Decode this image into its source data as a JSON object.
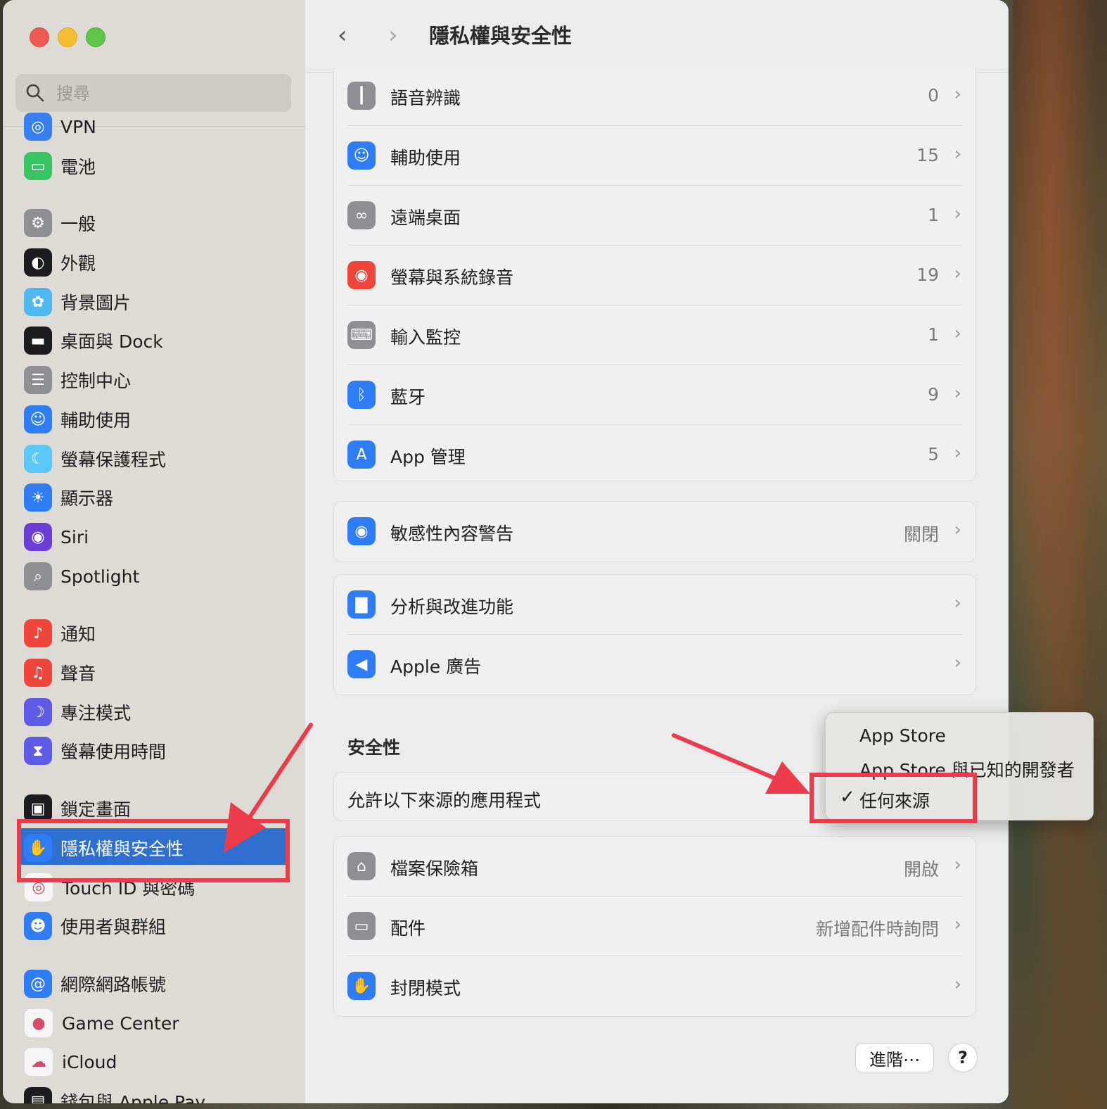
{
  "window": {
    "title": "隱私權與安全性"
  },
  "search": {
    "placeholder": "搜尋"
  },
  "sidebar": {
    "items": [
      {
        "label": "VPN",
        "icon": "vpn-icon",
        "color": "#3a7ff0"
      },
      {
        "label": "電池",
        "icon": "battery-icon",
        "color": "#38c463"
      },
      {
        "label": "一般",
        "icon": "gear-icon",
        "color": "#8e8e93"
      },
      {
        "label": "外觀",
        "icon": "appearance-icon",
        "color": "#1c1c1e"
      },
      {
        "label": "背景圖片",
        "icon": "wallpaper-icon",
        "color": "#4fb8f0"
      },
      {
        "label": "桌面與 Dock",
        "icon": "dock-icon",
        "color": "#1c1c1e"
      },
      {
        "label": "控制中心",
        "icon": "control-center-icon",
        "color": "#8e8e93"
      },
      {
        "label": "輔助使用",
        "icon": "accessibility-icon",
        "color": "#2e7cf6"
      },
      {
        "label": "螢幕保護程式",
        "icon": "screensaver-icon",
        "color": "#5ac8fa"
      },
      {
        "label": "顯示器",
        "icon": "display-icon",
        "color": "#2e7cf6"
      },
      {
        "label": "Siri",
        "icon": "siri-icon",
        "color": "#6b3fd6"
      },
      {
        "label": "Spotlight",
        "icon": "spotlight-icon",
        "color": "#8e8e93"
      },
      {
        "label": "通知",
        "icon": "notification-icon",
        "color": "#f0453a"
      },
      {
        "label": "聲音",
        "icon": "sound-icon",
        "color": "#f0453a"
      },
      {
        "label": "專注模式",
        "icon": "focus-moon-icon",
        "color": "#5e5ce6"
      },
      {
        "label": "螢幕使用時間",
        "icon": "hourglass-icon",
        "color": "#5e5ce6"
      },
      {
        "label": "鎖定畫面",
        "icon": "lock-icon",
        "color": "#1c1c1e"
      },
      {
        "label": "隱私權與安全性",
        "icon": "hand-icon",
        "color": "#2e7cf6"
      },
      {
        "label": "Touch ID 與密碼",
        "icon": "fingerprint-icon",
        "color": "#f5f5f5"
      },
      {
        "label": "使用者與群組",
        "icon": "users-icon",
        "color": "#2e7cf6"
      },
      {
        "label": "網際網路帳號",
        "icon": "at-icon",
        "color": "#2e7cf6"
      },
      {
        "label": "Game Center",
        "icon": "game-center-icon",
        "color": "#f5f5f5"
      },
      {
        "label": "iCloud",
        "icon": "icloud-icon",
        "color": "#f5f5f5"
      },
      {
        "label": "錢包與 Apple Pay",
        "icon": "wallet-icon",
        "color": "#1c1c1e"
      }
    ]
  },
  "cards": {
    "permissions": [
      {
        "label": "語音辨識",
        "value": "0",
        "icon": "waveform-icon",
        "color": "#8e8e93"
      },
      {
        "label": "輔助使用",
        "value": "15",
        "icon": "accessibility-icon",
        "color": "#2e7cf6"
      },
      {
        "label": "遠端桌面",
        "value": "1",
        "icon": "binoculars-icon",
        "color": "#8e8e93"
      },
      {
        "label": "螢幕與系統錄音",
        "value": "19",
        "icon": "record-icon",
        "color": "#f0453a"
      },
      {
        "label": "輸入監控",
        "value": "1",
        "icon": "keyboard-icon",
        "color": "#8e8e93"
      },
      {
        "label": "藍牙",
        "value": "9",
        "icon": "bluetooth-icon",
        "color": "#2e7cf6"
      },
      {
        "label": "App 管理",
        "value": "5",
        "icon": "app-store-icon",
        "color": "#2e7cf6"
      }
    ],
    "sensitive": [
      {
        "label": "敏感性內容警告",
        "value": "關閉",
        "icon": "eye-warning-icon",
        "color": "#2e7cf6"
      }
    ],
    "analytics": [
      {
        "label": "分析與改進功能",
        "value": "",
        "icon": "chart-icon",
        "color": "#2e7cf6"
      },
      {
        "label": "Apple 廣告",
        "value": "",
        "icon": "megaphone-icon",
        "color": "#2e7cf6"
      }
    ],
    "security_heading": "安全性",
    "allow_apps_label": "允許以下來源的應用程式",
    "security": [
      {
        "label": "檔案保險箱",
        "value": "開啟",
        "icon": "filevault-icon",
        "color": "#8e8e93"
      },
      {
        "label": "配件",
        "value": "新增配件時詢問",
        "icon": "accessory-icon",
        "color": "#8e8e93"
      },
      {
        "label": "封閉模式",
        "value": "",
        "icon": "hand-icon",
        "color": "#2e7cf6"
      }
    ]
  },
  "popup": {
    "options": [
      "App Store",
      "App Store 與已知的開發者",
      "任何來源"
    ],
    "selected": "任何來源",
    "check": "✓"
  },
  "footer": {
    "advanced_label": "進階⋯",
    "help_label": "?"
  },
  "colors": {
    "accent": "#2f6fd0",
    "annotation": "#ec3b4b"
  }
}
